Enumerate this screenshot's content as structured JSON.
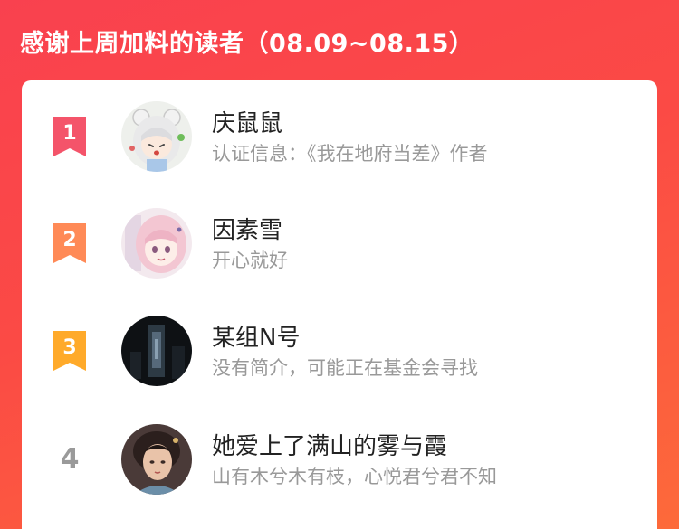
{
  "header": {
    "title": "感谢上周加料的读者（08.09~08.15）"
  },
  "colors": {
    "background_start": "#f9414f",
    "background_end": "#fd6a3a",
    "rank_1": "#f4546a",
    "rank_2": "#ff8a57",
    "rank_3": "#ffaa2a",
    "rank_other": "#9a9a9a"
  },
  "readers": [
    {
      "rank": "1",
      "name": "庆鼠鼠",
      "desc": "认证信息：《我在地府当差》作者"
    },
    {
      "rank": "2",
      "name": "因素雪",
      "desc": "开心就好"
    },
    {
      "rank": "3",
      "name": "某组N号",
      "desc": "没有简介，可能正在基金会寻找"
    },
    {
      "rank": "4",
      "name": "她爱上了满山的雾与霞",
      "desc": "山有木兮木有枝，心悦君兮君不知"
    }
  ]
}
